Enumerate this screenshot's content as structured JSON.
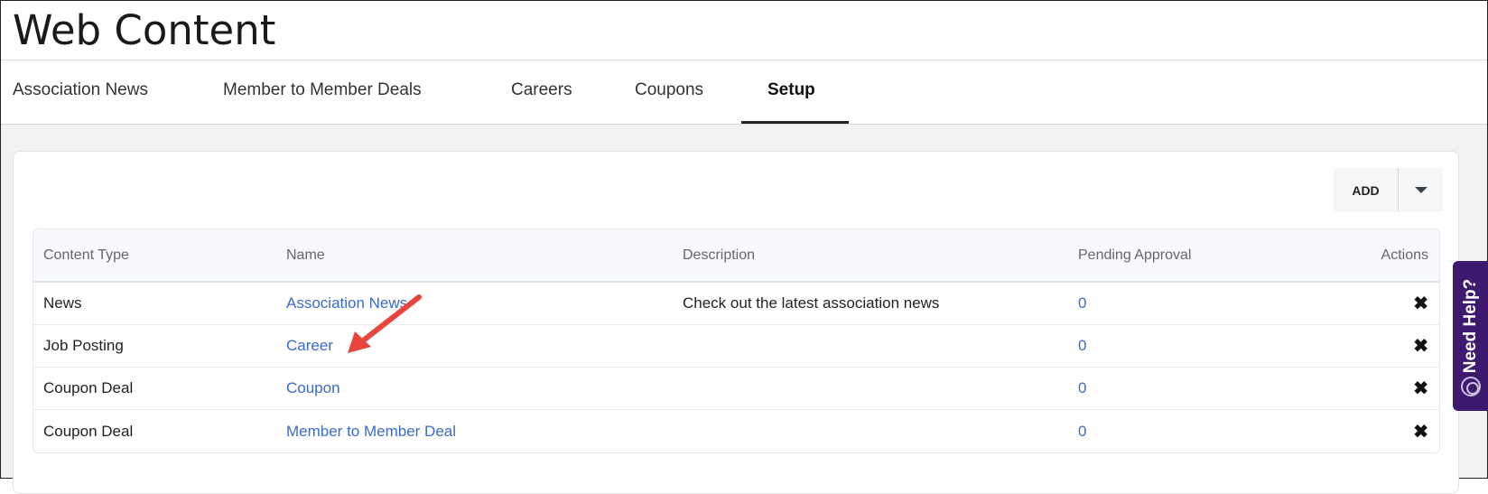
{
  "page": {
    "title": "Web Content"
  },
  "tabs": [
    {
      "label": "Association News"
    },
    {
      "label": "Member to Member Deals"
    },
    {
      "label": "Careers"
    },
    {
      "label": "Coupons"
    },
    {
      "label": "Setup",
      "active": true
    }
  ],
  "toolbar": {
    "add_label": "ADD",
    "dropdown_icon": "caret-down-icon"
  },
  "table": {
    "columns": [
      "Content Type",
      "Name",
      "Description",
      "Pending Approval",
      "Actions"
    ],
    "rows": [
      {
        "content_type": "News",
        "name": "Association News",
        "description": "Check out the latest association news",
        "pending": "0"
      },
      {
        "content_type": "Job Posting",
        "name": "Career",
        "description": "",
        "pending": "0"
      },
      {
        "content_type": "Coupon Deal",
        "name": "Coupon",
        "description": "",
        "pending": "0"
      },
      {
        "content_type": "Coupon Deal",
        "name": "Member to Member Deal",
        "description": "",
        "pending": "0"
      }
    ]
  },
  "help": {
    "label": "Need Help?",
    "icon": "lifebuoy-icon"
  },
  "colors": {
    "link": "#3b6bc9",
    "help_bg": "#3d1a6e",
    "annotation_arrow": "#e8453c",
    "active_tab_underline": "#222222"
  }
}
